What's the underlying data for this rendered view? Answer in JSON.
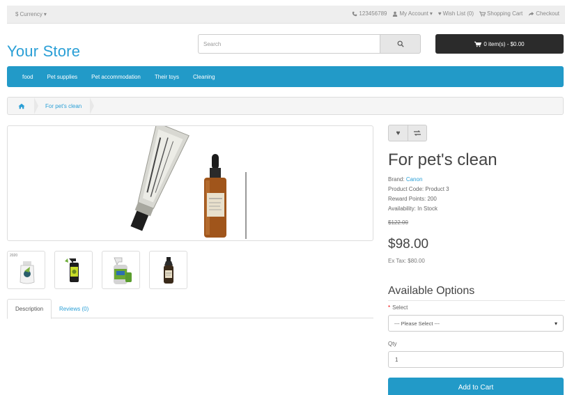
{
  "topbar": {
    "currency": "Currency",
    "currency_symbol": "$",
    "phone": "123456789",
    "my_account": "My Account",
    "wishlist": "Wish List (0)",
    "shopping_cart": "Shopping Cart",
    "checkout": "Checkout"
  },
  "header": {
    "logo": "Your Store",
    "search_placeholder": "Search",
    "cart_label": "0 item(s) - $0.00"
  },
  "menu": {
    "items": [
      "food",
      "Pet supplies",
      "Pet accommodation",
      "Their toys",
      "Cleaning"
    ]
  },
  "breadcrumb": {
    "current": "For pet's clean"
  },
  "tabs": {
    "description": "Description",
    "reviews": "Reviews (0)"
  },
  "thumbs": {
    "first_tag": "2020"
  },
  "product": {
    "title": "For pet's clean",
    "brand_label": "Brand:",
    "brand": "Canon",
    "code": "Product Code: Product 3",
    "reward": "Reward Points: 200",
    "availability": "Availability: In Stock",
    "old_price": "$122.00",
    "price": "$98.00",
    "ex_tax": "Ex Tax: $80.00"
  },
  "options": {
    "heading": "Available Options",
    "select_label": "Select",
    "select_value": "--- Please Select ---",
    "qty_label": "Qty",
    "qty_value": "1",
    "add_to_cart": "Add to Cart"
  },
  "colors": {
    "brand_blue": "#229ac8",
    "cart_dark": "#2b2b2b"
  }
}
